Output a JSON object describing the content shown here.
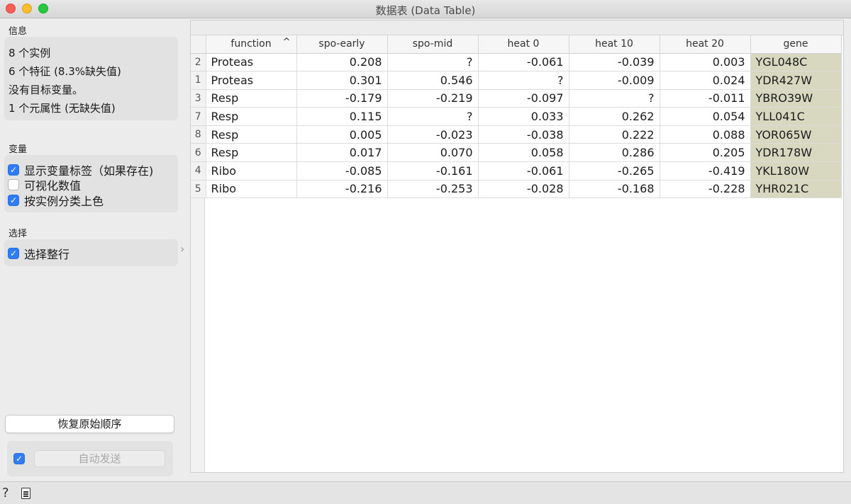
{
  "window": {
    "title": "数据表 (Data Table)"
  },
  "info": {
    "section_label": "信息",
    "lines": [
      "8 个实例",
      "6 个特征 (8.3%缺失值)",
      "没有目标变量。",
      "1 个元属性 (无缺失值)"
    ]
  },
  "variables": {
    "section_label": "变量",
    "options": [
      {
        "label": "显示变量标签（如果存在)",
        "checked": true
      },
      {
        "label": "可视化数值",
        "checked": false
      },
      {
        "label": "按实例分类上色",
        "checked": true
      }
    ]
  },
  "selection": {
    "section_label": "选择",
    "options": [
      {
        "label": "选择整行",
        "checked": true
      }
    ]
  },
  "buttons": {
    "restore_order": "恢复原始顺序",
    "auto_send": "自动发送",
    "auto_send_checked": true
  },
  "collapse_glyph": "›",
  "table": {
    "columns": [
      "function",
      "spo-early",
      "spo-mid",
      "heat 0",
      "heat 10",
      "heat 20",
      "gene"
    ],
    "sort_column": "function",
    "sort_glyph": "^",
    "rows": [
      {
        "index": "2",
        "cells": [
          "Proteas",
          "0.208",
          "?",
          "-0.061",
          "-0.039",
          "0.003",
          "YGL048C"
        ]
      },
      {
        "index": "1",
        "cells": [
          "Proteas",
          "0.301",
          "0.546",
          "?",
          "-0.009",
          "0.024",
          "YDR427W"
        ]
      },
      {
        "index": "3",
        "cells": [
          "Resp",
          "-0.179",
          "-0.219",
          "-0.097",
          "?",
          "-0.011",
          "YBRO39W"
        ]
      },
      {
        "index": "7",
        "cells": [
          "Resp",
          "0.115",
          "?",
          "0.033",
          "0.262",
          "0.054",
          "YLL041C"
        ]
      },
      {
        "index": "8",
        "cells": [
          "Resp",
          "0.005",
          "-0.023",
          "-0.038",
          "0.222",
          "0.088",
          "YOR065W"
        ]
      },
      {
        "index": "6",
        "cells": [
          "Resp",
          "0.017",
          "0.070",
          "0.058",
          "0.286",
          "0.205",
          "YDR178W"
        ]
      },
      {
        "index": "4",
        "cells": [
          "Ribo",
          "-0.085",
          "-0.161",
          "-0.061",
          "-0.265",
          "-0.419",
          "YKL180W"
        ]
      },
      {
        "index": "5",
        "cells": [
          "Ribo",
          "-0.216",
          "-0.253",
          "-0.028",
          "-0.168",
          "-0.228",
          "YHR021C"
        ]
      }
    ]
  },
  "status_bar": {
    "help_glyph": "?"
  },
  "colors": {
    "accent": "#2f7cf6",
    "meta_column_bg": "#d8d8c0"
  }
}
